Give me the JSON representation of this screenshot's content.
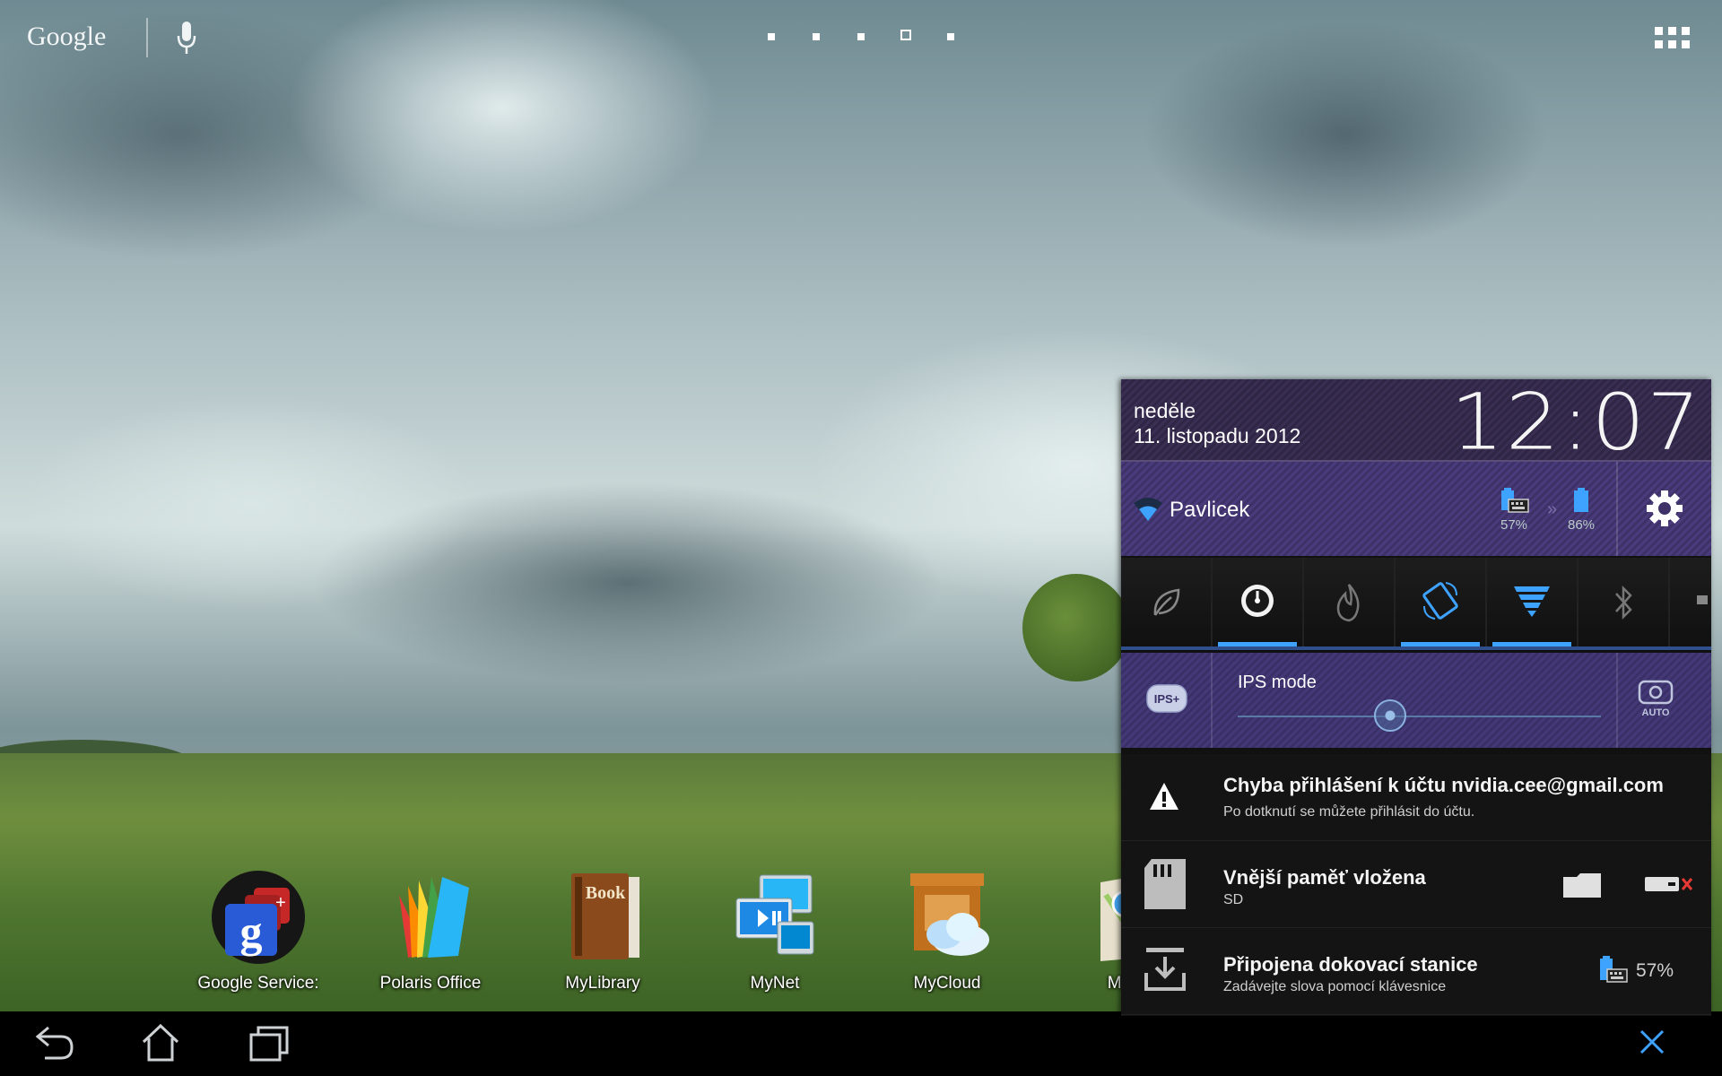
{
  "top_bar": {
    "google_logo": "Google"
  },
  "dock_apps": [
    {
      "label": "Google Service:"
    },
    {
      "label": "Polaris Office"
    },
    {
      "label": "MyLibrary"
    },
    {
      "label": "MyNet"
    },
    {
      "label": "MyCloud"
    },
    {
      "label": "Ma"
    }
  ],
  "mylibrary_icon_text": "Book",
  "panel": {
    "day_name": "neděle",
    "date": "11. listopadu 2012",
    "time": "12:07",
    "wifi_network": "Pavlicek",
    "dock_battery": "57%",
    "tablet_battery": "86%",
    "battery_arrows": "»",
    "ips_mode_label": "IPS mode",
    "ips_icon_text": "IPS+",
    "auto_icon_text": "AUTO",
    "notifications": [
      {
        "title": "Chyba přihlášení k účtu nvidia.cee@gmail.com",
        "subtitle": "Po dotknutí se můžete přihlásit do účtu.",
        "icon": "warning-icon"
      },
      {
        "title": "Vnější paměť vložena",
        "subtitle": "SD",
        "icon": "sd-card-icon"
      },
      {
        "title": "Připojena dokovací stanice",
        "subtitle": "Zadávejte slova pomocí klávesnice",
        "icon": "dock-download-icon",
        "extra": "57%"
      }
    ]
  },
  "colors": {
    "accent_blue": "#3ea2ff",
    "panel_purple": "#4a3c7c"
  }
}
